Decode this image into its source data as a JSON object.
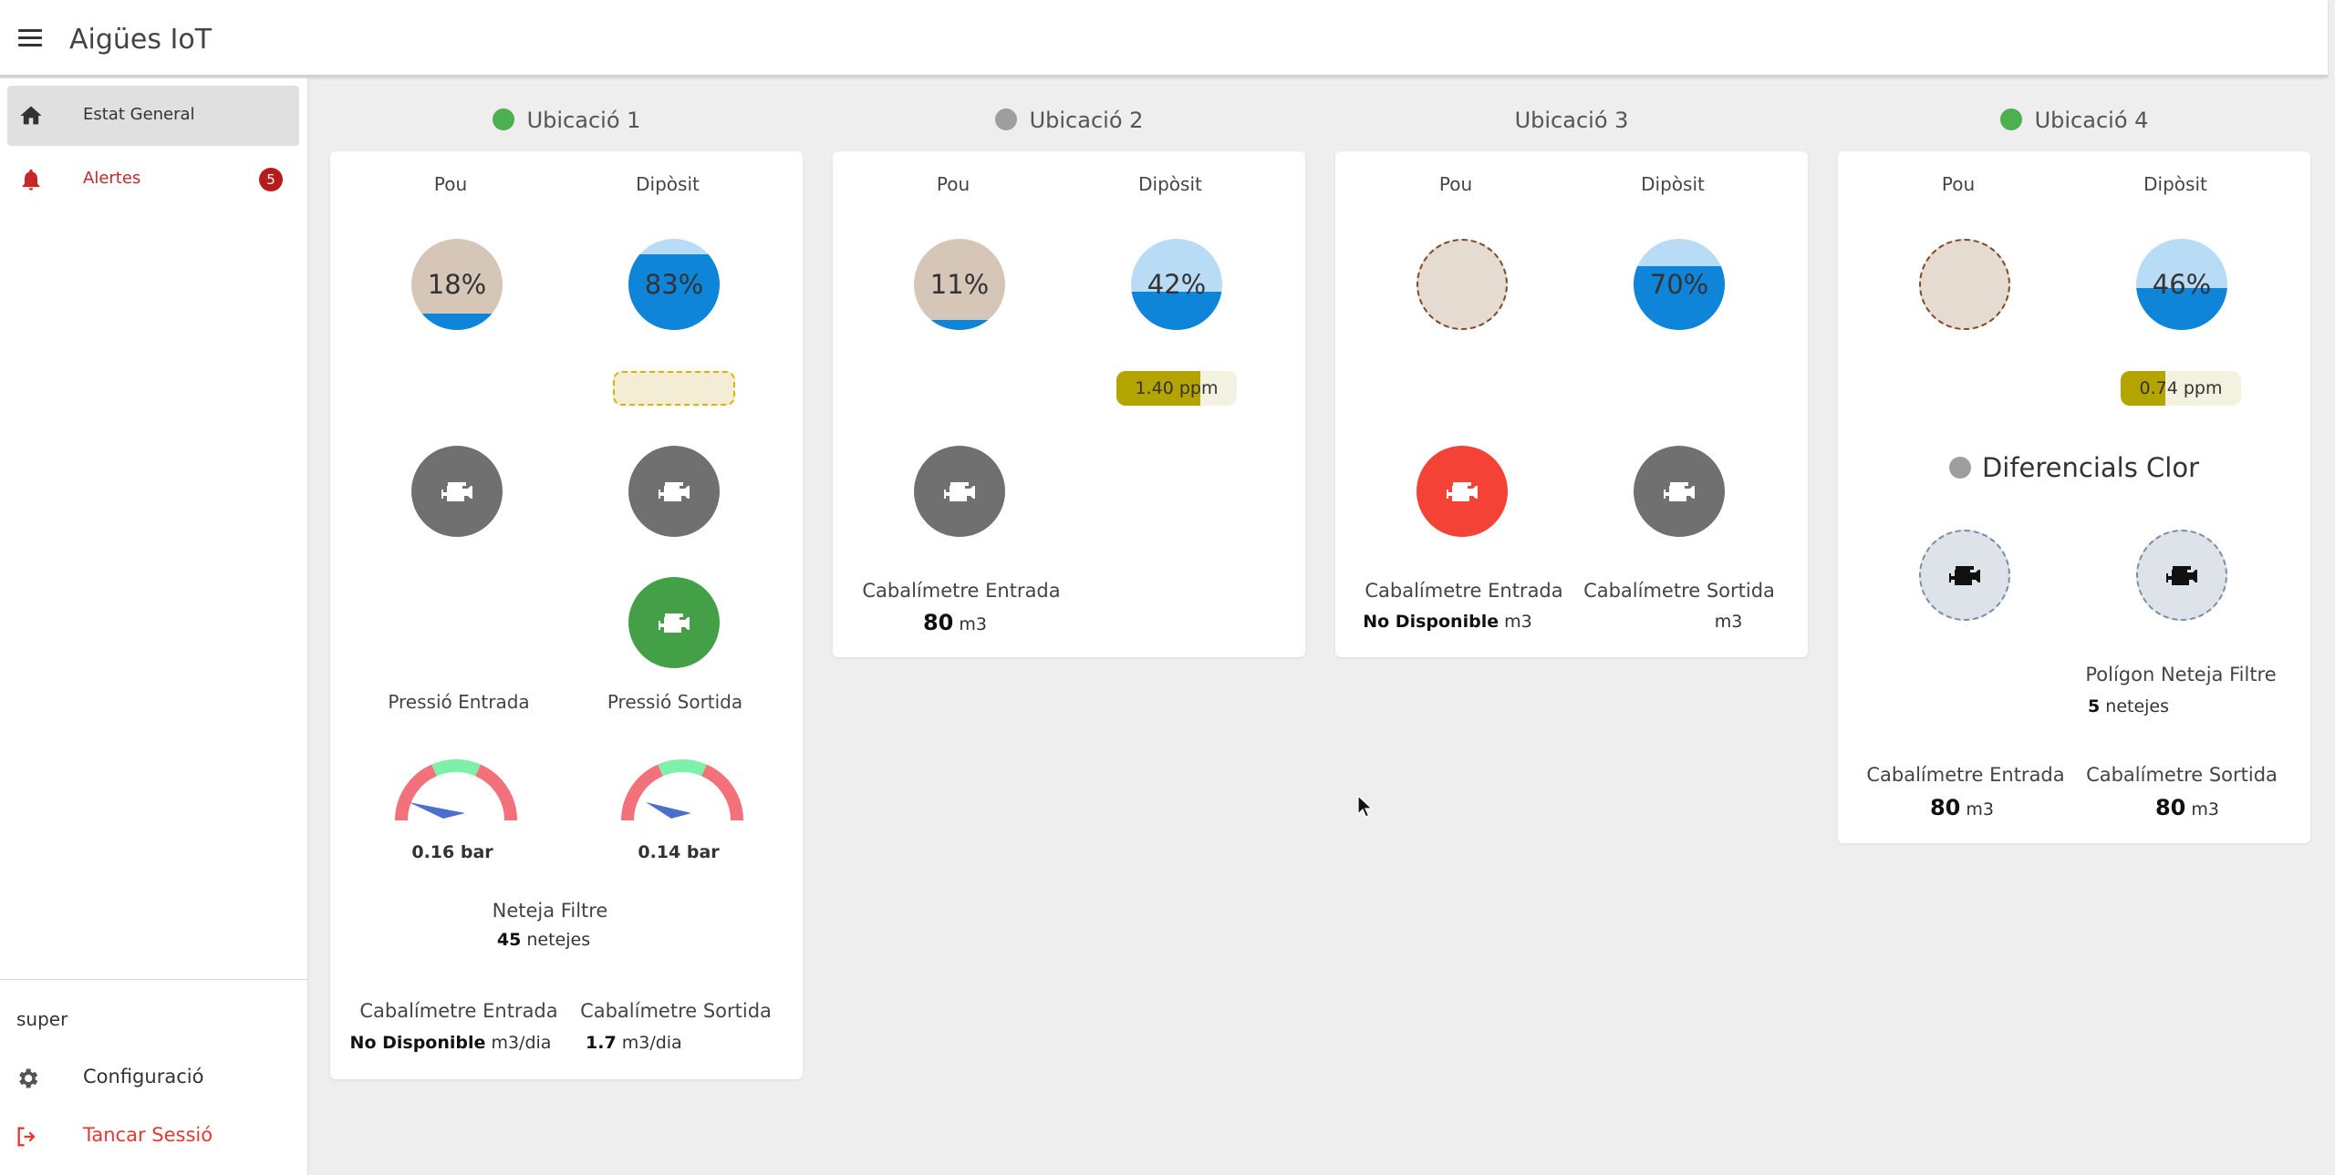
{
  "app": {
    "title": "Aigües IoT"
  },
  "nav": {
    "items": [
      {
        "label": "Estat General",
        "icon": "home-icon"
      },
      {
        "label": "Alertes",
        "icon": "bell-icon",
        "badge": "5"
      }
    ],
    "user": "super",
    "settings_label": "Configuració",
    "logout_label": "Tancar Sessió"
  },
  "colors": {
    "accent_red": "#c62828",
    "online": "#4caf50",
    "offline": "#9e9e9e",
    "well": "#d6c6b8",
    "water": "#0f85d9",
    "water_light": "#b8dcf5",
    "pump_off": "#707070",
    "pump_on": "#43a047",
    "pump_alarm": "#f44336"
  },
  "locations": [
    {
      "name": "Ubicació 1",
      "status": "online",
      "labels": {
        "well": "Pou",
        "tank": "Dipòsit",
        "p_in": "Pressió Entrada",
        "p_out": "Pressió Sortida",
        "filter": "Neteja Filtre",
        "flow_in": "Cabalímetre Entrada",
        "flow_out": "Cabalímetre Sortida"
      },
      "well_level": {
        "value": 18,
        "text": "18%"
      },
      "tank_level": {
        "value": 83,
        "text": "83%"
      },
      "pressure_in": "0.16 bar",
      "pressure_out": "0.14 bar",
      "filter_count": "45",
      "filter_unit": "netejes",
      "flow_in": {
        "value": "No Disponible",
        "unit": "m3/dia"
      },
      "flow_out": {
        "value": "1.7",
        "unit": "m3/dia"
      }
    },
    {
      "name": "Ubicació 2",
      "status": "offline",
      "labels": {
        "well": "Pou",
        "tank": "Dipòsit",
        "flow_in": "Cabalímetre Entrada"
      },
      "well_level": {
        "value": 11,
        "text": "11%"
      },
      "tank_level": {
        "value": 42,
        "text": "42%"
      },
      "chlorine": {
        "text": "1.40 ppm",
        "fraction": 0.7
      },
      "flow_in": {
        "value": "80",
        "unit": "m3"
      }
    },
    {
      "name": "Ubicació 3",
      "status": "none",
      "labels": {
        "well": "Pou",
        "tank": "Dipòsit",
        "flow_in": "Cabalímetre Entrada",
        "flow_out": "Cabalímetre Sortida"
      },
      "tank_level": {
        "value": 70,
        "text": "70%"
      },
      "flow_in": {
        "value": "No Disponible",
        "unit": "m3"
      },
      "flow_out": {
        "value": "",
        "unit": "m3"
      }
    },
    {
      "name": "Ubicació 4",
      "status": "online",
      "labels": {
        "well": "Pou",
        "tank": "Dipòsit",
        "diff": "Diferencials Clor",
        "filter": "Polígon Neteja Filtre",
        "flow_in": "Cabalímetre Entrada",
        "flow_out": "Cabalímetre Sortida"
      },
      "tank_level": {
        "value": 46,
        "text": "46%"
      },
      "chlorine": {
        "text": "0.74 ppm",
        "fraction": 0.37
      },
      "filter_count": "5",
      "filter_unit": "netejes",
      "flow_in": {
        "value": "80",
        "unit": "m3"
      },
      "flow_out": {
        "value": "80",
        "unit": "m3"
      }
    }
  ]
}
